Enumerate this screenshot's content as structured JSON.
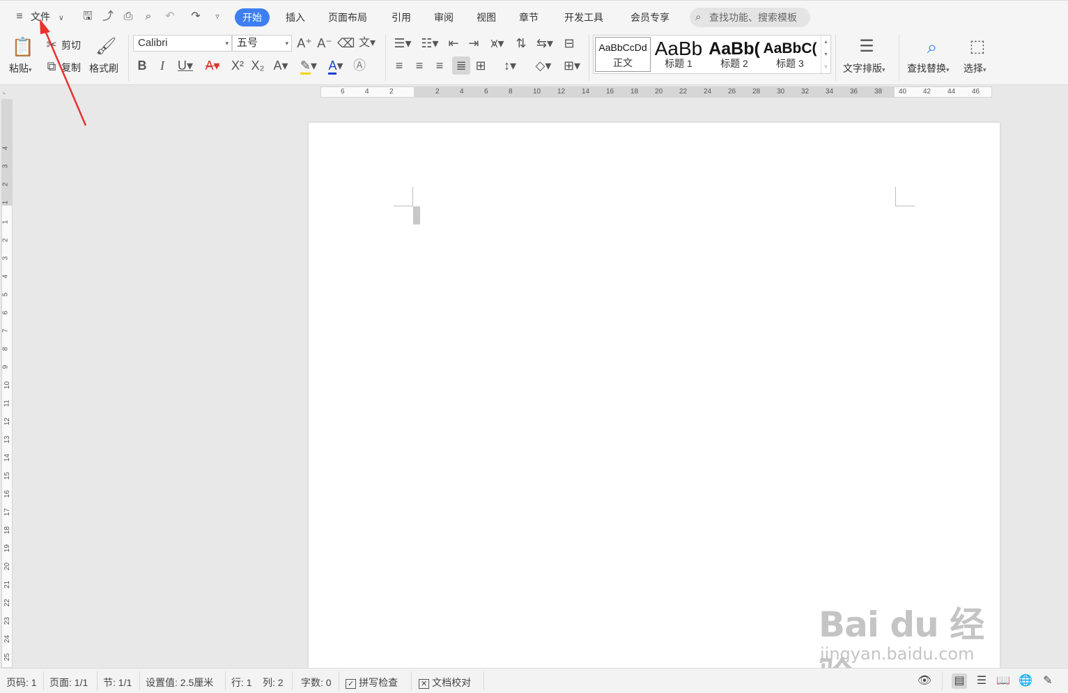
{
  "menu": {
    "label": "文件"
  },
  "tabs": [
    {
      "label": "开始"
    },
    {
      "label": "插入"
    },
    {
      "label": "页面布局"
    },
    {
      "label": "引用"
    },
    {
      "label": "审阅"
    },
    {
      "label": "视图"
    },
    {
      "label": "章节"
    },
    {
      "label": "开发工具"
    },
    {
      "label": "会员专享"
    }
  ],
  "search": {
    "placeholder": "查找功能、搜索模板"
  },
  "ribbon": {
    "paste": "粘贴",
    "cut": "剪切",
    "copy": "复制",
    "format_painter": "格式刷",
    "font_name": "Calibri",
    "font_size": "五号",
    "styles": [
      {
        "preview": "AaBbCcDd",
        "label": "正文"
      },
      {
        "preview": "AaBb",
        "label": "标题 1"
      },
      {
        "preview": "AaBb(",
        "label": "标题 2"
      },
      {
        "preview": "AaBbC(",
        "label": "标题 3"
      }
    ],
    "text_layout": "文字排版",
    "find_replace": "查找替换",
    "select": "选择"
  },
  "ruler": {
    "h_left": [
      "6",
      "4",
      "2"
    ],
    "h_right": [
      "2",
      "4",
      "6",
      "8",
      "10",
      "12",
      "14",
      "16",
      "18",
      "20",
      "22",
      "24",
      "26",
      "28",
      "30",
      "32",
      "34",
      "36",
      "38",
      "40",
      "42",
      "44",
      "46"
    ],
    "v_top": [
      "4",
      "3",
      "2",
      "1"
    ],
    "v_main": [
      "1",
      "2",
      "3",
      "4",
      "5",
      "6",
      "7",
      "8",
      "9",
      "10",
      "11",
      "12",
      "13",
      "14",
      "15",
      "16",
      "17",
      "18",
      "19",
      "20",
      "21",
      "22",
      "23",
      "24",
      "25"
    ]
  },
  "status": {
    "page": "页码: 1",
    "pages": "页面: 1/1",
    "section": "节: 1/1",
    "setting": "设置值: 2.5厘米",
    "row": "行: 1",
    "col": "列: 2",
    "words": "字数: 0",
    "spell": "拼写检查",
    "proof": "文档校对"
  },
  "watermark": {
    "line1": "Bai du 经验",
    "line2": "jingyan.baidu.com"
  },
  "colors": {
    "accent": "#3d7ff0",
    "arrow": "#e8322e",
    "font_color": "#1a3fd1",
    "highlight": "#f5d400",
    "strike": "#d9332a"
  }
}
